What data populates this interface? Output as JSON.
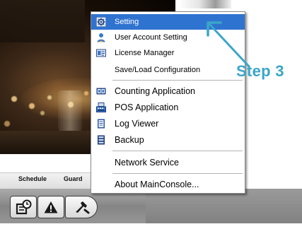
{
  "menu": {
    "items": [
      {
        "label": "Setting",
        "icon": "gear-icon",
        "selected": true
      },
      {
        "label": "User Account Setting",
        "icon": "user-icon"
      },
      {
        "label": "License Manager",
        "icon": "license-card-icon"
      },
      {
        "label": "Save/Load Configuration",
        "icon": ""
      },
      {
        "label": "Counting Application",
        "icon": "counting-app-icon"
      },
      {
        "label": "POS Application",
        "icon": "pos-register-icon"
      },
      {
        "label": "Log Viewer",
        "icon": "log-document-icon"
      },
      {
        "label": "Backup",
        "icon": "backup-icon"
      },
      {
        "label": "Network Service",
        "icon": ""
      },
      {
        "label": "About MainConsole...",
        "icon": ""
      }
    ]
  },
  "annotation": {
    "step_label": "Step 3",
    "color": "#3aa6c8"
  },
  "tabs": {
    "schedule": "Schedule",
    "guard": "Guard"
  },
  "toolbar": {
    "buttons": [
      "schedule-icon",
      "warning-icon",
      "tools-icon"
    ]
  },
  "colors": {
    "selection": "#2f73d0",
    "accent": "#3aa6c8"
  }
}
